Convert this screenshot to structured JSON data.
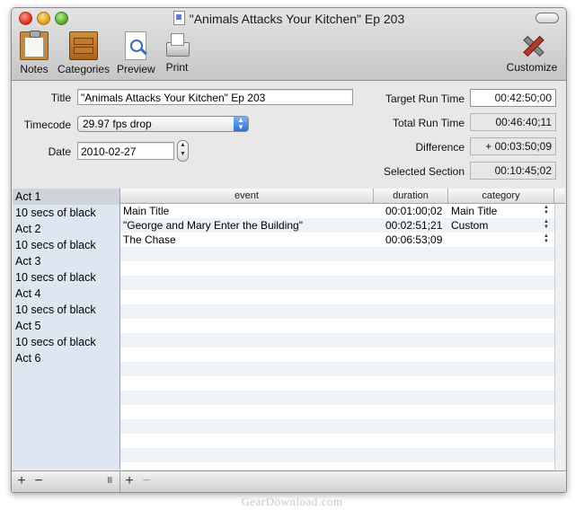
{
  "window": {
    "title": "\"Animals Attacks Your Kitchen\" Ep 203"
  },
  "toolbar": {
    "items": [
      {
        "label": "Notes",
        "icon": "notes-icon"
      },
      {
        "label": "Categories",
        "icon": "categories-icon"
      },
      {
        "label": "Preview",
        "icon": "preview-icon"
      },
      {
        "label": "Print",
        "icon": "print-icon"
      }
    ],
    "customize": {
      "label": "Customize",
      "icon": "tools-icon"
    }
  },
  "form": {
    "title_label": "Title",
    "title_value": "\"Animals Attacks Your Kitchen\" Ep 203",
    "timecode_label": "Timecode",
    "timecode_value": "29.97 fps drop",
    "date_label": "Date",
    "date_value": "2010-02-27",
    "target_label": "Target Run Time",
    "target_value": "00:42:50;00",
    "total_label": "Total Run Time",
    "total_value": "00:46:40;11",
    "difference_label": "Difference",
    "difference_value": "+ 00:03:50;09",
    "selected_label": "Selected Section",
    "selected_value": "00:10:45;02"
  },
  "sidebar": {
    "items": [
      "Act 1",
      "10 secs of black",
      "Act 2",
      "10 secs of black",
      "Act 3",
      "10 secs of black",
      "Act 4",
      "10 secs of black",
      "Act 5",
      "10 secs of black",
      "Act 6"
    ],
    "selected_index": 0
  },
  "table": {
    "columns": [
      "event",
      "duration",
      "category"
    ],
    "rows": [
      {
        "event": "Main Title",
        "duration": "00:01:00;02",
        "category": "Main Title"
      },
      {
        "event": "\"George and Mary Enter the Building\"",
        "duration": "00:02:51;21",
        "category": "Custom"
      },
      {
        "event": "The Chase",
        "duration": "00:06:53;09",
        "category": ""
      }
    ]
  },
  "bottom": {
    "add": "+",
    "remove": "−",
    "grip": "III"
  },
  "watermark": "GearDownload.com",
  "colors": {
    "stripe": "#eef3fa",
    "sidebar_bg": "#dde6f1",
    "popup_accent": "#2d6fd3"
  }
}
